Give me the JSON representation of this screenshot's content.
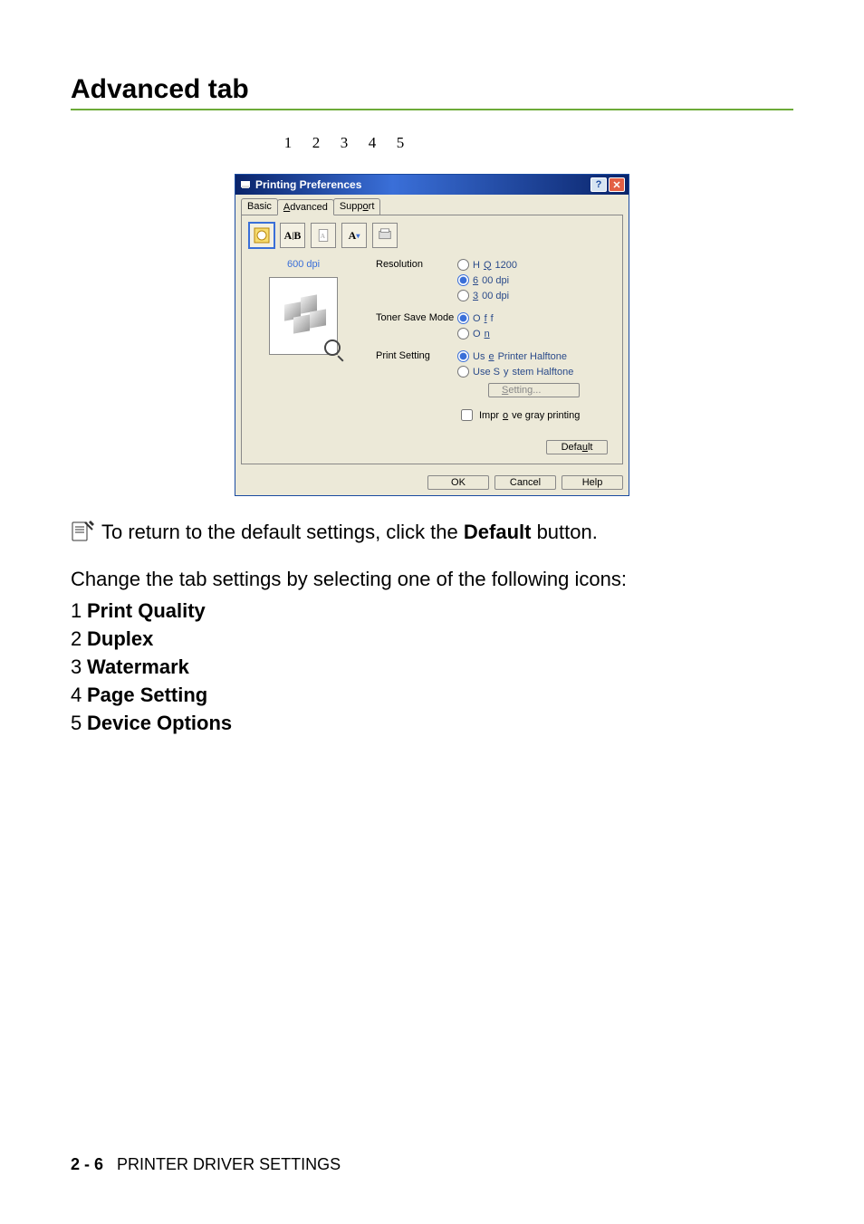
{
  "section_title": "Advanced tab",
  "callouts": [
    "1",
    "2",
    "3",
    "4",
    "5"
  ],
  "dialog": {
    "title": "Printing Preferences",
    "tabs": {
      "basic": "Basic",
      "advanced": "Advanced",
      "support": "Support"
    },
    "preview_label": "600 dpi",
    "settings": {
      "resolution": {
        "label": "Resolution",
        "options": {
          "hq": "HQ 1200",
          "r600": "600 dpi",
          "r300": "300 dpi"
        }
      },
      "toner": {
        "label": "Toner Save Mode",
        "options": {
          "off": "Off",
          "on": "On"
        }
      },
      "print": {
        "label": "Print Setting",
        "options": {
          "printer": "Use Printer Halftone",
          "system": "Use System Halftone"
        },
        "setting_btn": "Setting...",
        "improve_gray": "Improve gray printing"
      }
    },
    "buttons": {
      "default": "Default",
      "ok": "OK",
      "cancel": "Cancel",
      "help": "Help"
    }
  },
  "note_text_prefix": "To return to the default settings, click the ",
  "note_text_bold": "Default",
  "note_text_suffix": " button.",
  "intro_text": "Change the tab settings by selecting one of the following icons:",
  "items": [
    {
      "num": "1",
      "label": "Print Quality"
    },
    {
      "num": "2",
      "label": "Duplex"
    },
    {
      "num": "3",
      "label": "Watermark"
    },
    {
      "num": "4",
      "label": "Page Setting"
    },
    {
      "num": "5",
      "label": "Device Options"
    }
  ],
  "footer": {
    "page": "2 - 6",
    "chapter": "PRINTER DRIVER SETTINGS"
  }
}
